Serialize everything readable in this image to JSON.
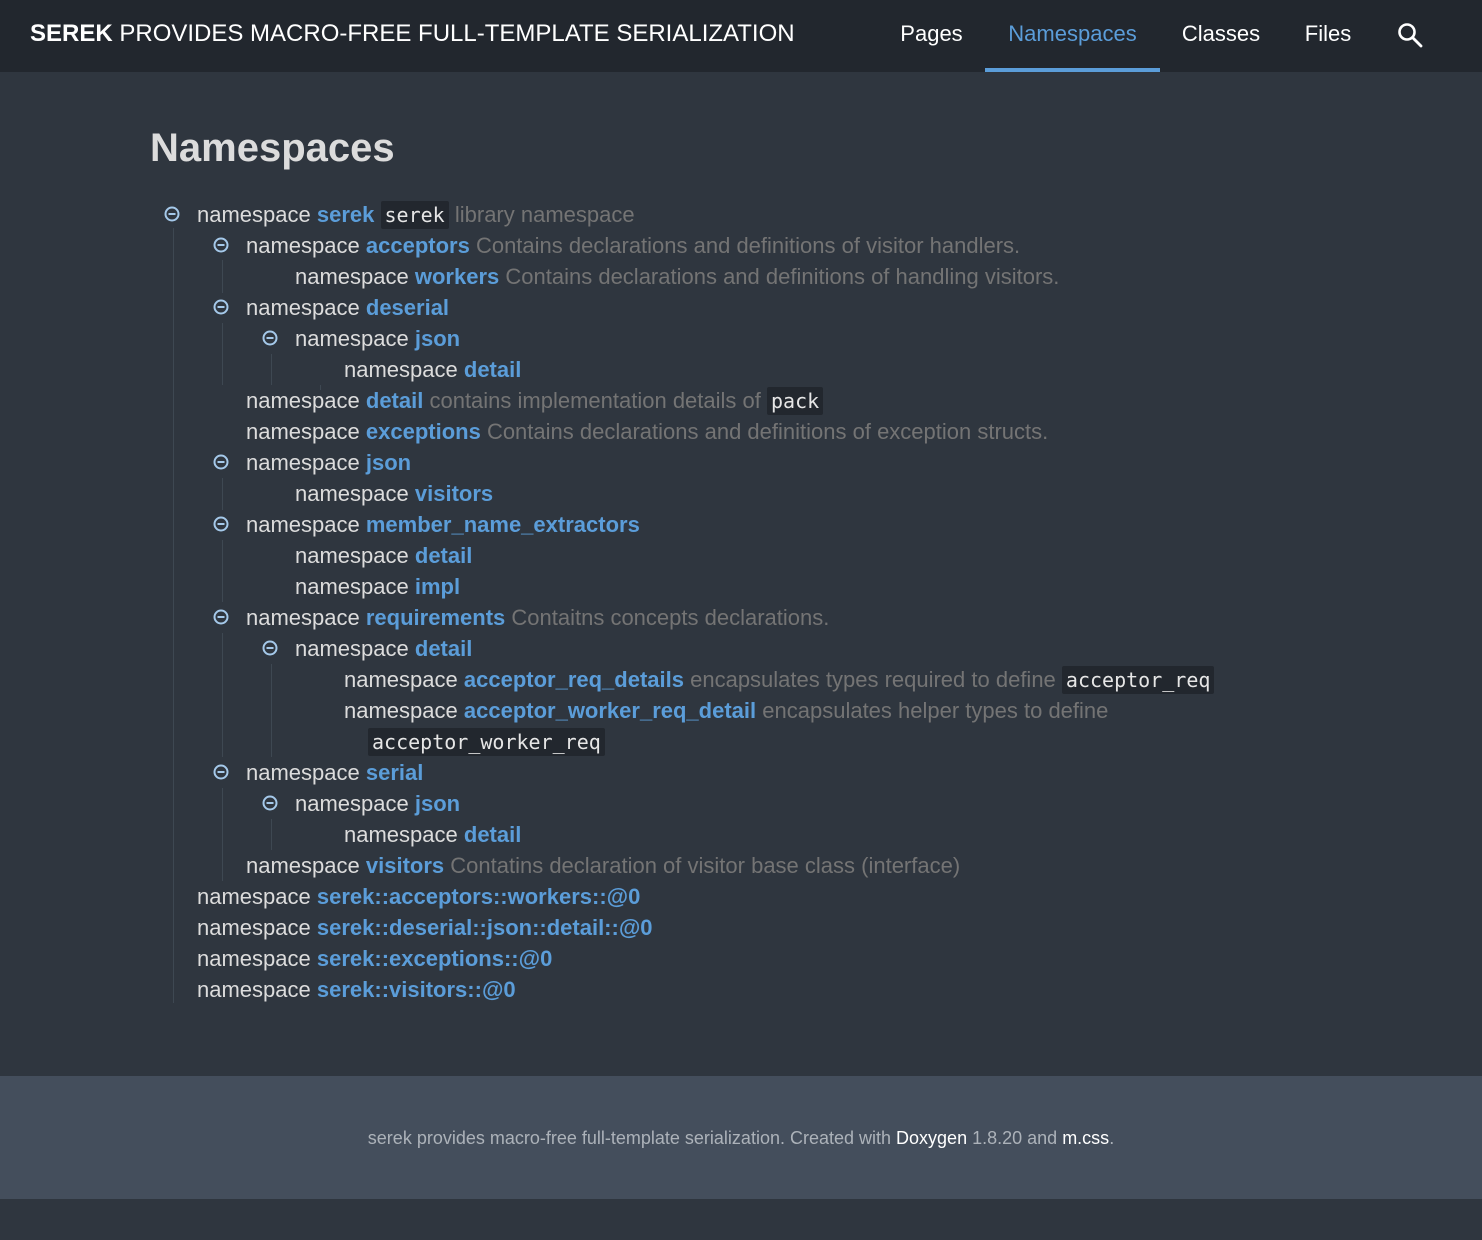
{
  "header": {
    "brand_bold": "SEREK",
    "brand_rest": "PROVIDES MACRO-FREE FULL-TEMPLATE SERIALIZATION",
    "nav": [
      "Pages",
      "Namespaces",
      "Classes",
      "Files"
    ],
    "active_nav": "Namespaces",
    "search_icon": "search-icon"
  },
  "page": {
    "title": "Namespaces"
  },
  "tree": [
    {
      "kw": "namespace",
      "name": "serek",
      "code": "serek",
      "desc": "library namespace"
    },
    {
      "kw": "namespace",
      "name": "acceptors",
      "desc": "Contains declarations and definitions of visitor handlers."
    },
    {
      "kw": "namespace",
      "name": "workers",
      "desc": "Contains declarations and definitions of handling visitors."
    },
    {
      "kw": "namespace",
      "name": "deserial"
    },
    {
      "kw": "namespace",
      "name": "json"
    },
    {
      "kw": "namespace",
      "name": "detail"
    },
    {
      "kw": "namespace",
      "name": "detail",
      "desc": "contains implementation details of",
      "code_after": "pack"
    },
    {
      "kw": "namespace",
      "name": "exceptions",
      "desc": "Contains declarations and definitions of exception structs."
    },
    {
      "kw": "namespace",
      "name": "json"
    },
    {
      "kw": "namespace",
      "name": "visitors"
    },
    {
      "kw": "namespace",
      "name": "member_name_extractors"
    },
    {
      "kw": "namespace",
      "name": "detail"
    },
    {
      "kw": "namespace",
      "name": "impl"
    },
    {
      "kw": "namespace",
      "name": "requirements",
      "desc": "Contaitns concepts declarations."
    },
    {
      "kw": "namespace",
      "name": "detail"
    },
    {
      "kw": "namespace",
      "name": "acceptor_req_details",
      "desc": "encapsulates types required to define",
      "code_after": "acceptor_req"
    },
    {
      "kw": "namespace",
      "name": "acceptor_worker_req_detail",
      "desc": "encapsulates helper types to define",
      "code_next_line": "acceptor_worker_req"
    },
    {
      "kw": "namespace",
      "name": "serial"
    },
    {
      "kw": "namespace",
      "name": "json"
    },
    {
      "kw": "namespace",
      "name": "detail"
    },
    {
      "kw": "namespace",
      "name": "visitors",
      "desc": "Contatins declaration of visitor base class (interface)"
    },
    {
      "kw": "namespace",
      "name": "serek::acceptors::workers::@0"
    },
    {
      "kw": "namespace",
      "name": "serek::deserial::json::detail::@0"
    },
    {
      "kw": "namespace",
      "name": "serek::exceptions::@0"
    },
    {
      "kw": "namespace",
      "name": "serek::visitors::@0"
    }
  ],
  "toggle_icon": "collapse-minus-icon",
  "footer": {
    "prefix": "serek provides macro-free full-template serialization. Created with",
    "link1": "Doxygen",
    "version": "1.8.20 and",
    "link2": "m.css",
    "suffix": "."
  }
}
